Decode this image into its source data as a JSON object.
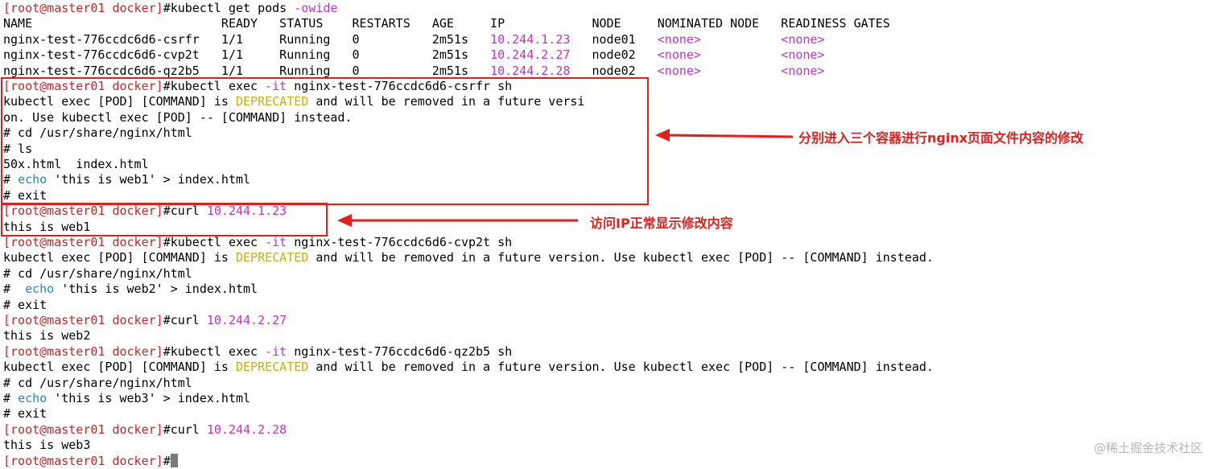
{
  "terminal": {
    "prompt_user": "root@master01 docker",
    "lines": [
      {
        "parts": [
          {
            "t": "[root@master01 docker]",
            "c": "red"
          },
          {
            "t": "#kubectl get pods "
          },
          {
            "t": "-owide",
            "c": "mag"
          }
        ]
      },
      {
        "parts": [
          {
            "t": "NAME                          READY   STATUS    RESTARTS   AGE     IP            NODE     NOMINATED NODE   READINESS GATES"
          }
        ]
      },
      {
        "parts": [
          {
            "t": "nginx-test-776ccdc6d6-csrfr   1/1     Running   0          2m51s   "
          },
          {
            "t": "10.244.1.23",
            "c": "mag"
          },
          {
            "t": "   node01   "
          },
          {
            "t": "<none>",
            "c": "mag"
          },
          {
            "t": "           "
          },
          {
            "t": "<none>",
            "c": "mag"
          }
        ]
      },
      {
        "parts": [
          {
            "t": "nginx-test-776ccdc6d6-cvp2t   1/1     Running   0          2m51s   "
          },
          {
            "t": "10.244.2.27",
            "c": "mag"
          },
          {
            "t": "   node02   "
          },
          {
            "t": "<none>",
            "c": "mag"
          },
          {
            "t": "           "
          },
          {
            "t": "<none>",
            "c": "mag"
          }
        ]
      },
      {
        "parts": [
          {
            "t": "nginx-test-776ccdc6d6-qz2b5   1/1     Running   0          2m51s   "
          },
          {
            "t": "10.244.2.28",
            "c": "mag"
          },
          {
            "t": "   node02   "
          },
          {
            "t": "<none>",
            "c": "mag"
          },
          {
            "t": "           "
          },
          {
            "t": "<none>",
            "c": "mag"
          }
        ]
      },
      {
        "parts": [
          {
            "t": "[root@master01 docker]",
            "c": "red"
          },
          {
            "t": "#kubectl exec "
          },
          {
            "t": "-it",
            "c": "mag"
          },
          {
            "t": " nginx-test-776ccdc6d6-csrfr sh"
          }
        ]
      },
      {
        "parts": [
          {
            "t": "kubectl exec [POD] [COMMAND] is "
          },
          {
            "t": "DEPRECATED",
            "c": "yel"
          },
          {
            "t": " and will be removed in a future versi"
          }
        ]
      },
      {
        "parts": [
          {
            "t": "on. Use kubectl exec [POD] -- [COMMAND] instead."
          }
        ]
      },
      {
        "parts": [
          {
            "t": "# cd /usr/share/nginx/html"
          }
        ]
      },
      {
        "parts": [
          {
            "t": "# ls"
          }
        ]
      },
      {
        "parts": [
          {
            "t": "50x.html  index.html"
          }
        ]
      },
      {
        "parts": [
          {
            "t": "# "
          },
          {
            "t": "echo",
            "c": "cyan"
          },
          {
            "t": " 'this is web1' > index.html"
          }
        ]
      },
      {
        "parts": [
          {
            "t": "# exit"
          }
        ]
      },
      {
        "parts": [
          {
            "t": "[root@master01 docker]",
            "c": "red"
          },
          {
            "t": "#curl "
          },
          {
            "t": "10.244.1.23",
            "c": "mag"
          }
        ]
      },
      {
        "parts": [
          {
            "t": "this is web1"
          }
        ]
      },
      {
        "parts": [
          {
            "t": "[root@master01 docker]",
            "c": "red"
          },
          {
            "t": "#kubectl exec "
          },
          {
            "t": "-it",
            "c": "mag"
          },
          {
            "t": " nginx-test-776ccdc6d6-cvp2t sh"
          }
        ]
      },
      {
        "parts": [
          {
            "t": "kubectl exec [POD] [COMMAND] is "
          },
          {
            "t": "DEPRECATED",
            "c": "yel"
          },
          {
            "t": " and will be removed in a future version. Use kubectl exec [POD] -- [COMMAND] instead."
          }
        ]
      },
      {
        "parts": [
          {
            "t": "# cd /usr/share/nginx/html"
          }
        ]
      },
      {
        "parts": [
          {
            "t": "#  "
          },
          {
            "t": "echo",
            "c": "cyan"
          },
          {
            "t": " 'this is web2' > index.html"
          }
        ]
      },
      {
        "parts": [
          {
            "t": "# exit"
          }
        ]
      },
      {
        "parts": [
          {
            "t": "[root@master01 docker]",
            "c": "red"
          },
          {
            "t": "#curl "
          },
          {
            "t": "10.244.2.27",
            "c": "mag"
          }
        ]
      },
      {
        "parts": [
          {
            "t": "this is web2"
          }
        ]
      },
      {
        "parts": [
          {
            "t": "[root@master01 docker]",
            "c": "red"
          },
          {
            "t": "#kubectl exec "
          },
          {
            "t": "-it",
            "c": "mag"
          },
          {
            "t": " nginx-test-776ccdc6d6-qz2b5 sh"
          }
        ]
      },
      {
        "parts": [
          {
            "t": "kubectl exec [POD] [COMMAND] is "
          },
          {
            "t": "DEPRECATED",
            "c": "yel"
          },
          {
            "t": " and will be removed in a future version. Use kubectl exec [POD] -- [COMMAND] instead."
          }
        ]
      },
      {
        "parts": [
          {
            "t": "# cd /usr/share/nginx/html"
          }
        ]
      },
      {
        "parts": [
          {
            "t": "# "
          },
          {
            "t": "echo",
            "c": "cyan"
          },
          {
            "t": " 'this is web3' > index.html"
          }
        ]
      },
      {
        "parts": [
          {
            "t": "# exit"
          }
        ]
      },
      {
        "parts": [
          {
            "t": "[root@master01 docker]",
            "c": "red"
          },
          {
            "t": "#curl "
          },
          {
            "t": "10.244.2.28",
            "c": "mag"
          }
        ]
      },
      {
        "parts": [
          {
            "t": "this is web3"
          }
        ]
      },
      {
        "parts": [
          {
            "t": "[root@master01 docker]",
            "c": "red"
          },
          {
            "t": "#"
          }
        ],
        "cursor": true
      }
    ]
  },
  "annotations": {
    "exec_note": "分别进入三个容器进行nginx页面文件内容的修改",
    "curl_note": "访问IP正常显示修改内容"
  },
  "watermark": "@稀土掘金技术社区",
  "colors": {
    "prompt": "#c4282a",
    "highlight": "#c233c8",
    "builtin": "#2a8bb5",
    "deprecated": "#c8b010",
    "annotation": "#e0201c"
  }
}
